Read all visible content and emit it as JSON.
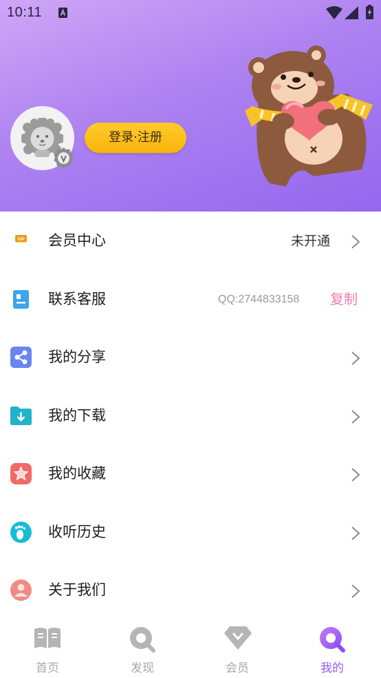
{
  "status_bar": {
    "time": "10:11"
  },
  "header": {
    "login_label": "登录·注册"
  },
  "menu": {
    "vip": {
      "icon_text": "VIP",
      "label": "会员中心",
      "value": "未开通"
    },
    "service": {
      "label": "联系客服",
      "qq": "QQ:2744833158",
      "copy": "复制"
    },
    "share": {
      "label": "我的分享"
    },
    "download": {
      "label": "我的下载"
    },
    "favorites": {
      "label": "我的收藏"
    },
    "history": {
      "label": "收听历史"
    },
    "about": {
      "label": "关于我们"
    }
  },
  "bottom_nav": {
    "items": [
      {
        "label": "首页",
        "icon": "book-icon"
      },
      {
        "label": "发现",
        "icon": "search-icon"
      },
      {
        "label": "会员",
        "icon": "diamond-icon"
      },
      {
        "label": "我的",
        "icon": "profile-search-icon",
        "active": true
      }
    ]
  },
  "colors": {
    "header_gradient_start": "#cfa6f6",
    "header_gradient_end": "#9467ee",
    "login_button": "#ffc21e",
    "accent": "#9a5cf2",
    "copy_link": "#f07dae"
  }
}
